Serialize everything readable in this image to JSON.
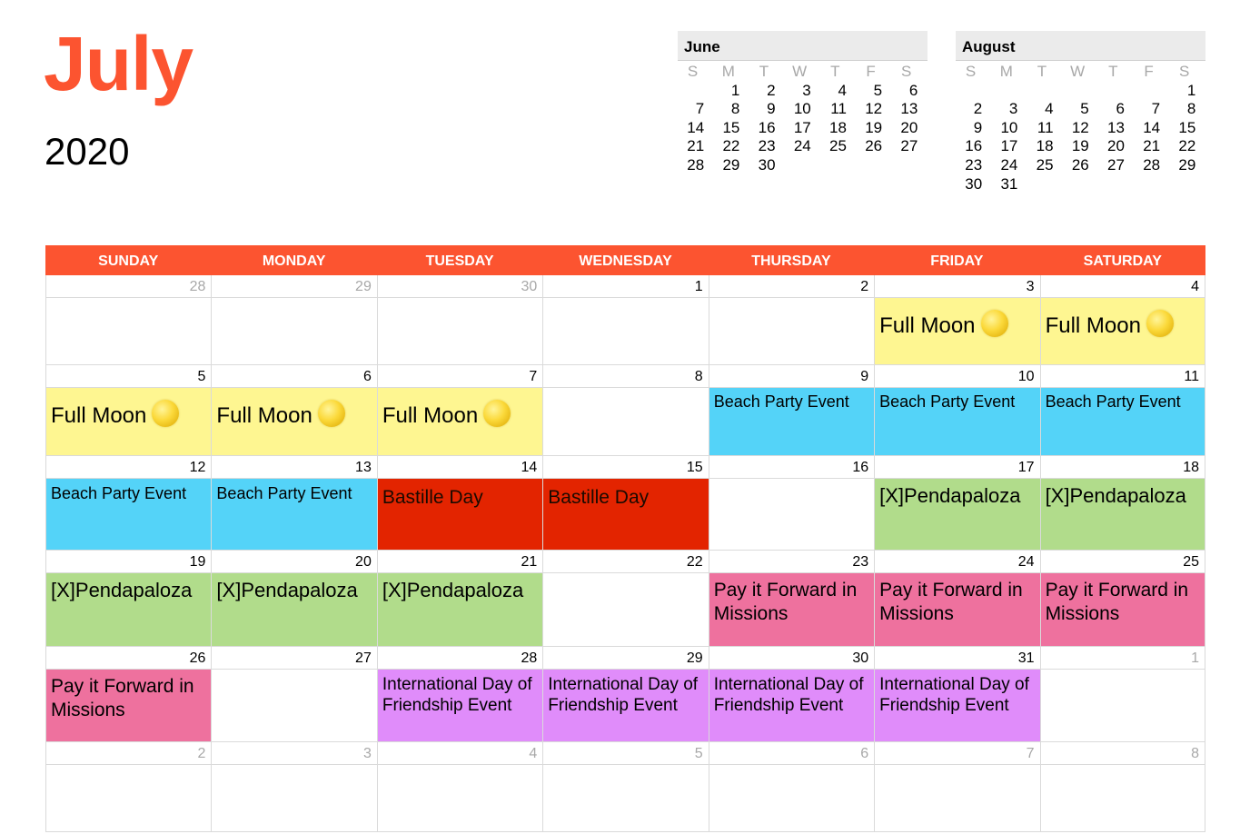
{
  "header": {
    "month": "July",
    "year": "2020"
  },
  "mini_calendars": [
    {
      "name": "June",
      "dow": [
        "S",
        "M",
        "T",
        "W",
        "T",
        "F",
        "S"
      ],
      "cells": [
        "",
        "1",
        "2",
        "3",
        "4",
        "5",
        "6",
        "7",
        "8",
        "9",
        "10",
        "11",
        "12",
        "13",
        "14",
        "15",
        "16",
        "17",
        "18",
        "19",
        "20",
        "21",
        "22",
        "23",
        "24",
        "25",
        "26",
        "27",
        "28",
        "29",
        "30",
        "",
        "",
        "",
        ""
      ]
    },
    {
      "name": "August",
      "dow": [
        "S",
        "M",
        "T",
        "W",
        "T",
        "F",
        "S"
      ],
      "cells": [
        "",
        "",
        "",
        "",
        "",
        "",
        "1",
        "2",
        "3",
        "4",
        "5",
        "6",
        "7",
        "8",
        "9",
        "10",
        "11",
        "12",
        "13",
        "14",
        "15",
        "16",
        "17",
        "18",
        "19",
        "20",
        "21",
        "22",
        "23",
        "24",
        "25",
        "26",
        "27",
        "28",
        "29",
        "30",
        "31",
        "",
        "",
        "",
        "",
        ""
      ]
    }
  ],
  "weekdays": [
    "SUNDAY",
    "MONDAY",
    "TUESDAY",
    "WEDNESDAY",
    "THURSDAY",
    "FRIDAY",
    "SATURDAY"
  ],
  "event_colors": {
    "full_moon": "#fef691",
    "beach_party": "#54d3f8",
    "bastille_day": "#e32400",
    "pendapaloza": "#b1dc8b",
    "pay_it_forward": "#ee719e",
    "friendship": "#e08cfa",
    "header_accent": "#fc5430"
  },
  "weeks": [
    [
      {
        "day": "28",
        "other": true,
        "event": "",
        "type": ""
      },
      {
        "day": "29",
        "other": true,
        "event": "",
        "type": ""
      },
      {
        "day": "30",
        "other": true,
        "event": "",
        "type": ""
      },
      {
        "day": "1",
        "other": false,
        "event": "",
        "type": ""
      },
      {
        "day": "2",
        "other": false,
        "event": "",
        "type": ""
      },
      {
        "day": "3",
        "other": false,
        "event": "Full Moon",
        "type": "moon",
        "icon": "full-moon-icon"
      },
      {
        "day": "4",
        "other": false,
        "event": "Full Moon",
        "type": "moon",
        "icon": "full-moon-icon"
      }
    ],
    [
      {
        "day": "5",
        "other": false,
        "event": "Full Moon",
        "type": "moon",
        "icon": "full-moon-icon"
      },
      {
        "day": "6",
        "other": false,
        "event": "Full Moon",
        "type": "moon",
        "icon": "full-moon-icon"
      },
      {
        "day": "7",
        "other": false,
        "event": "Full Moon",
        "type": "moon",
        "icon": "full-moon-icon"
      },
      {
        "day": "8",
        "other": false,
        "event": "",
        "type": ""
      },
      {
        "day": "9",
        "other": false,
        "event": "Beach Party  Event",
        "type": "beach"
      },
      {
        "day": "10",
        "other": false,
        "event": "Beach Party  Event",
        "type": "beach"
      },
      {
        "day": "11",
        "other": false,
        "event": "Beach Party  Event",
        "type": "beach"
      }
    ],
    [
      {
        "day": "12",
        "other": false,
        "event": "Beach Party Event",
        "type": "beach2"
      },
      {
        "day": "13",
        "other": false,
        "event": "Beach Party Event",
        "type": "beach2"
      },
      {
        "day": "14",
        "other": false,
        "event": "Bastille Day",
        "type": "bastille"
      },
      {
        "day": "15",
        "other": false,
        "event": "Bastille Day",
        "type": "bastille"
      },
      {
        "day": "16",
        "other": false,
        "event": "",
        "type": ""
      },
      {
        "day": "17",
        "other": false,
        "event": "[X]Pendapaloza",
        "type": "penda"
      },
      {
        "day": "18",
        "other": false,
        "event": "[X]Pendapaloza",
        "type": "penda"
      }
    ],
    [
      {
        "day": "19",
        "other": false,
        "event": "[X]Pendapaloza",
        "type": "penda"
      },
      {
        "day": "20",
        "other": false,
        "event": "[X]Pendapaloza",
        "type": "penda"
      },
      {
        "day": "21",
        "other": false,
        "event": "[X]Pendapaloza",
        "type": "penda"
      },
      {
        "day": "22",
        "other": false,
        "event": "",
        "type": ""
      },
      {
        "day": "23",
        "other": false,
        "event": "Pay it Forward in Missions",
        "type": "pay"
      },
      {
        "day": "24",
        "other": false,
        "event": "Pay it Forward in Missions",
        "type": "pay"
      },
      {
        "day": "25",
        "other": false,
        "event": "Pay it Forward in Missions",
        "type": "pay"
      }
    ],
    [
      {
        "day": "26",
        "other": false,
        "event": "Pay it Forward in Missions",
        "type": "pay"
      },
      {
        "day": "27",
        "other": false,
        "event": "",
        "type": ""
      },
      {
        "day": "28",
        "other": false,
        "event": "International Day of Friendship Event",
        "type": "intl"
      },
      {
        "day": "29",
        "other": false,
        "event": "International Day of Friendship Event",
        "type": "intl"
      },
      {
        "day": "30",
        "other": false,
        "event": "International Day of Friendship Event",
        "type": "intl"
      },
      {
        "day": "31",
        "other": false,
        "event": "International Day of Friendship Event",
        "type": "intl"
      },
      {
        "day": "1",
        "other": true,
        "event": "",
        "type": ""
      }
    ],
    [
      {
        "day": "2",
        "other": true,
        "event": "",
        "type": ""
      },
      {
        "day": "3",
        "other": true,
        "event": "",
        "type": ""
      },
      {
        "day": "4",
        "other": true,
        "event": "",
        "type": ""
      },
      {
        "day": "5",
        "other": true,
        "event": "",
        "type": ""
      },
      {
        "day": "6",
        "other": true,
        "event": "",
        "type": ""
      },
      {
        "day": "7",
        "other": true,
        "event": "",
        "type": ""
      },
      {
        "day": "8",
        "other": true,
        "event": "",
        "type": ""
      }
    ]
  ]
}
